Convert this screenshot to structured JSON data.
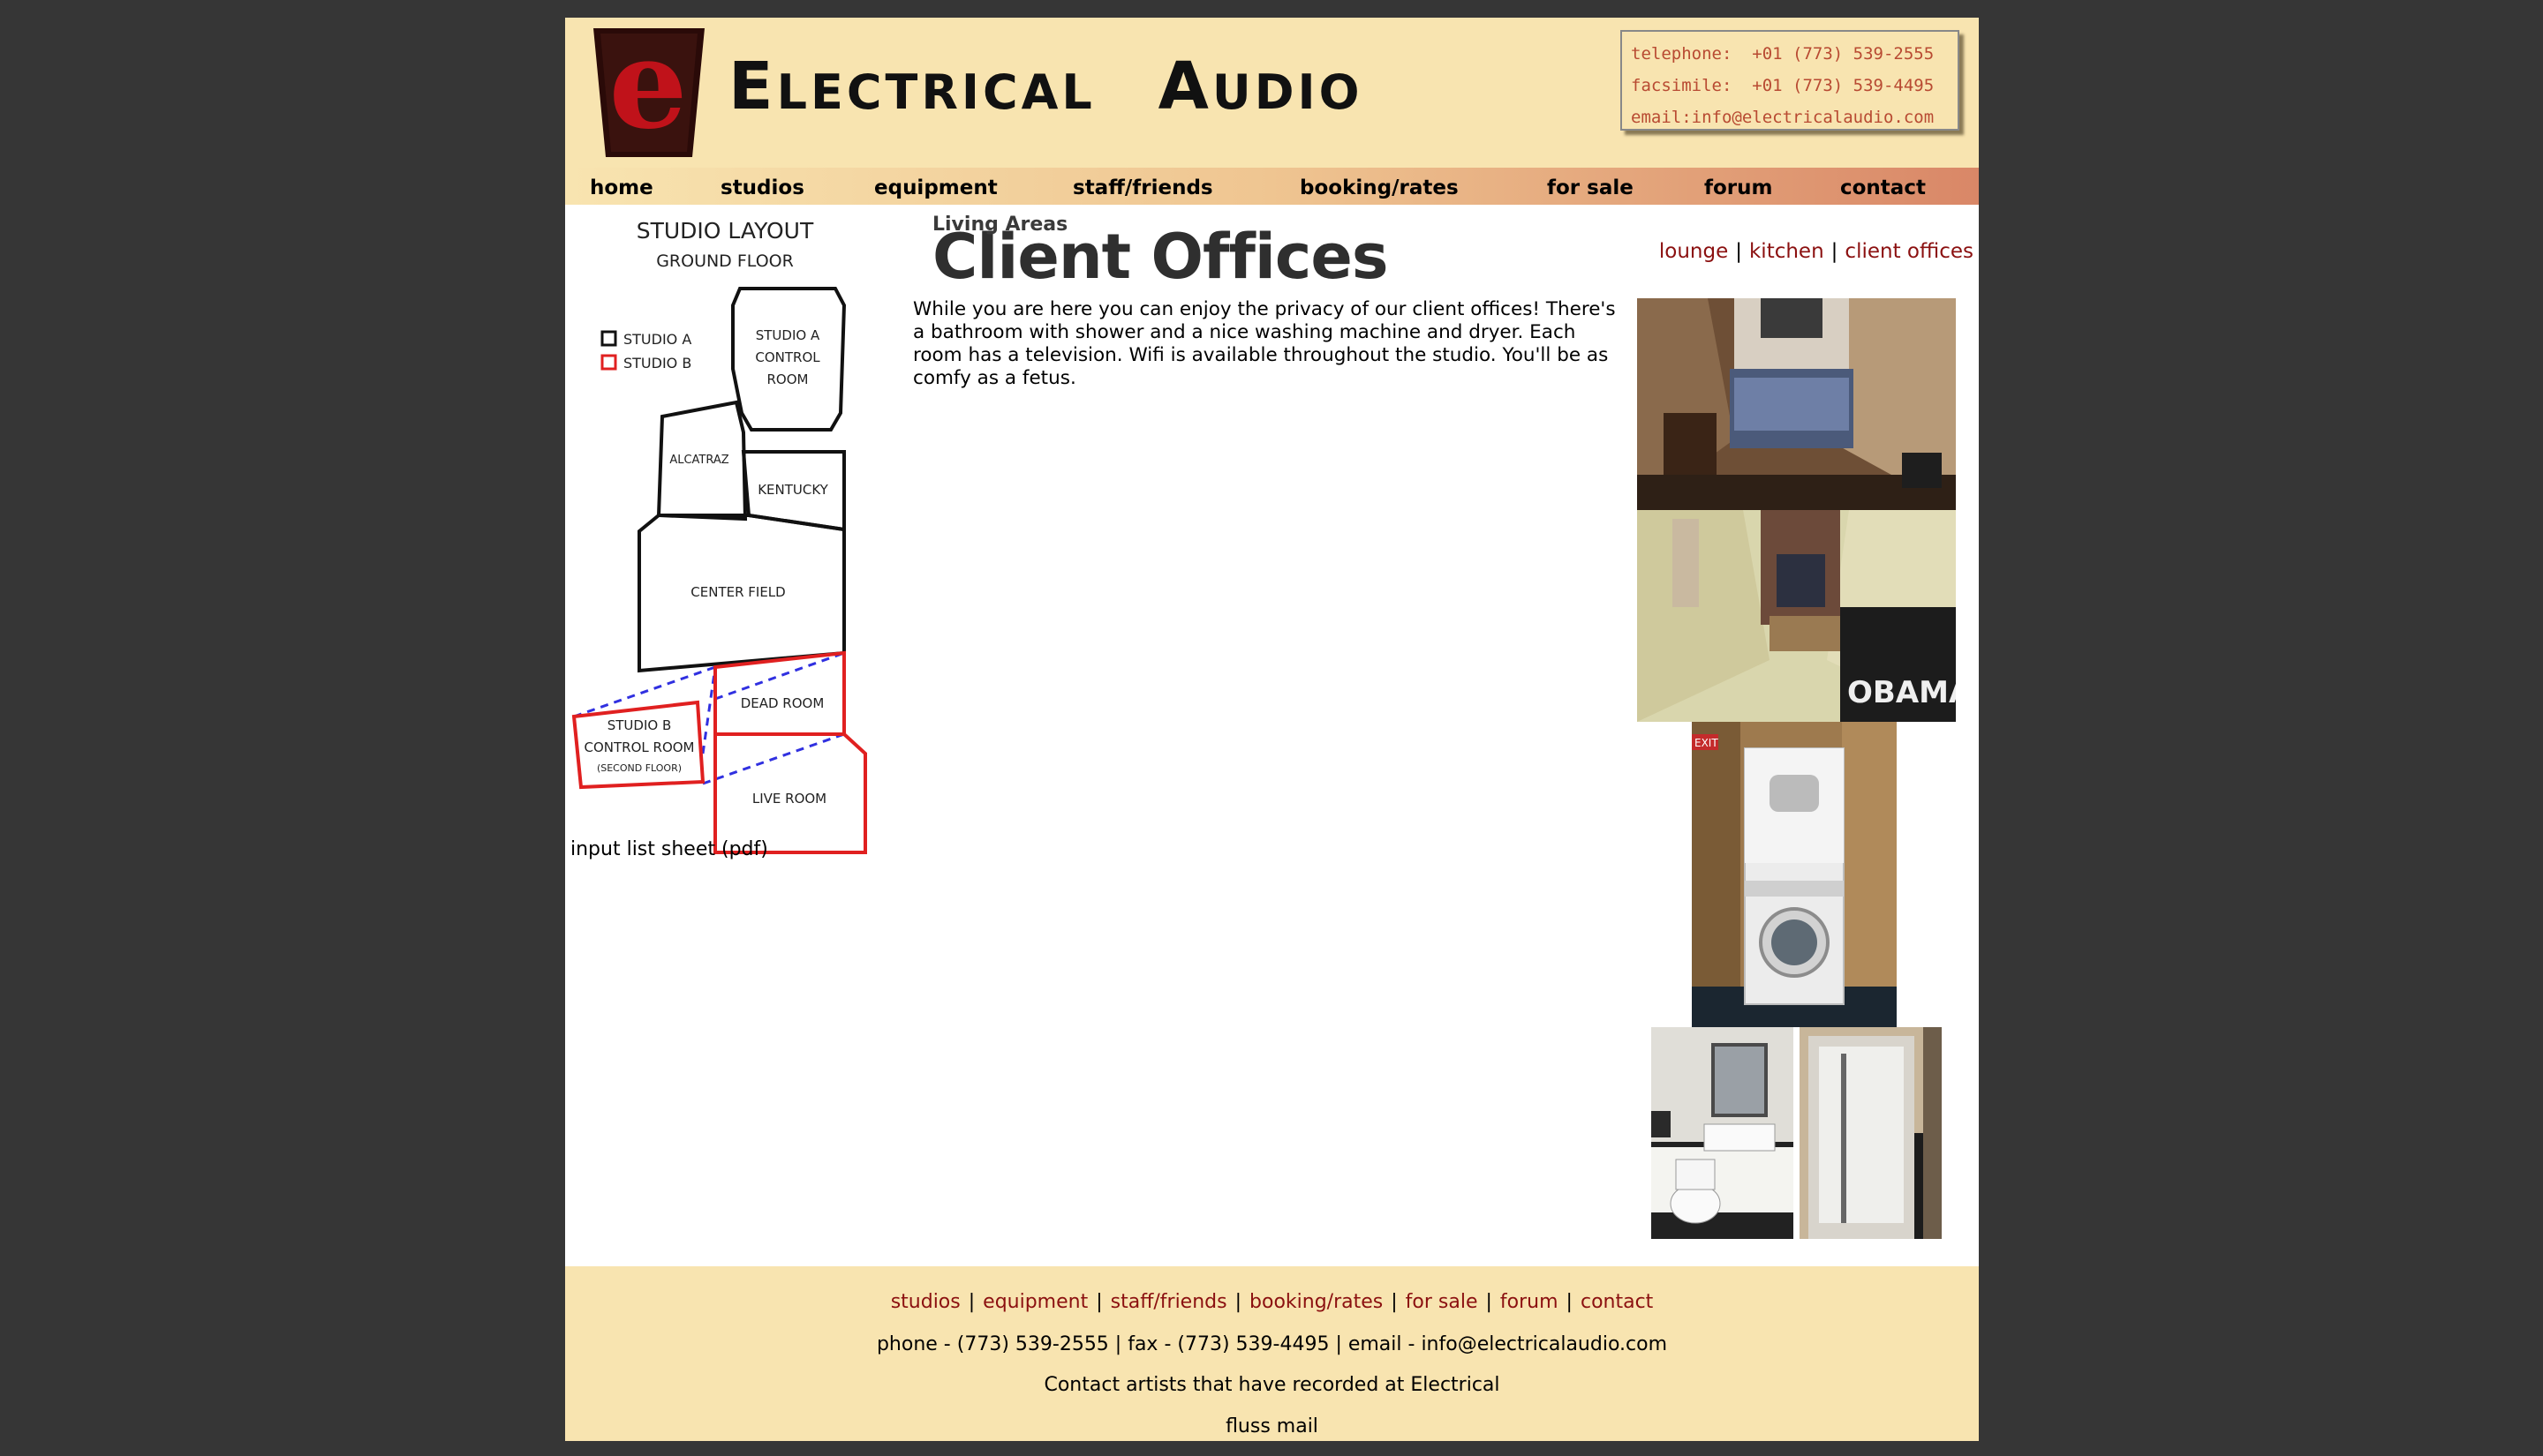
{
  "brand": {
    "logo_letter": "e",
    "name_first_cap": "E",
    "name_first_rest": "LECTRICAL",
    "name_second_cap": "A",
    "name_second_rest": "UDIO"
  },
  "contact_card": {
    "telephone": "telephone:  +01 (773) 539-2555",
    "facsimile": "facsimile:  +01 (773) 539-4495",
    "email": "email:info@electricalaudio.com"
  },
  "nav": {
    "items": [
      "home",
      "studios",
      "equipment",
      "staff/friends",
      "booking/rates",
      "for sale",
      "forum",
      "contact"
    ]
  },
  "sidebar": {
    "map": {
      "title": "STUDIO LAYOUT",
      "subtitle": "GROUND FLOOR",
      "legend_a": "STUDIO A",
      "legend_b": "STUDIO B",
      "rooms": {
        "studio_a_control": [
          "STUDIO A",
          "CONTROL",
          "ROOM"
        ],
        "alcatraz": "ALCATRAZ",
        "kentucky": "KENTUCKY",
        "center_field": "CENTER FIELD",
        "dead_room": "DEAD ROOM",
        "studio_b_control": [
          "STUDIO B",
          "CONTROL ROOM",
          "(SECOND FLOOR)"
        ],
        "live_room": "LIVE ROOM"
      },
      "colors": {
        "studio_a": "#111111",
        "studio_b": "#e02020",
        "link_line": "#3030e0"
      }
    },
    "input_list_label": "input list sheet (pdf)"
  },
  "main": {
    "section_label": "Living Areas",
    "title": "Client Offices",
    "subnav": [
      "lounge",
      "kitchen",
      "client offices"
    ],
    "body": "While you are here you can enjoy the privacy of our client offices! There's a bathroom with shower and a nice washing machine and dryer. Each room has a television. Wifi is available throughout the studio. You'll be as comfy as a fetus."
  },
  "photos": {
    "bedroom_two_blanket_text": "OBAMA",
    "exit_sign": "EXIT"
  },
  "footer": {
    "links": [
      "studios",
      "equipment",
      "staff/friends",
      "booking/rates",
      "for sale",
      "forum",
      "contact"
    ],
    "phone_line": "phone - (773) 539-2555 | fax - (773) 539-4495 | email - info@electricalaudio.com",
    "artists_line": "Contact artists that have recorded at Electrical",
    "fluss_line": "fluss mail"
  },
  "colors": {
    "background": "#363636",
    "header_bg": "#f8e4b0",
    "link": "#8b1010",
    "contact_text": "#b84a32",
    "logo_red": "#c0121a"
  }
}
